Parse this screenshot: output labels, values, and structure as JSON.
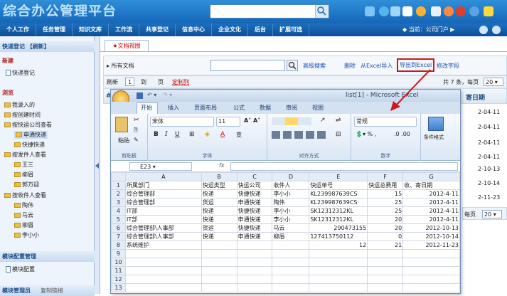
{
  "header": {
    "logo": "综合办公管理平台",
    "top_icons": [
      "home-icon",
      "info-icon",
      "monitor-icon",
      "shirt-icon",
      "sun-icon",
      "mail-icon",
      "flower-icon",
      "power-icon",
      "user-icon",
      "note-icon"
    ]
  },
  "nav": {
    "items": [
      "个人工作",
      "任务管理",
      "知识文库",
      "工作流",
      "共享登记",
      "信息中心",
      "企业文化",
      "后台",
      "扩展可选"
    ],
    "location": "◆ 当前：公司门户 ▶"
  },
  "sidebar": {
    "quick_title": "快递登记 【刷新】",
    "new_label": "新建",
    "new_item": "快递登记",
    "browse_label": "浏览",
    "tree": [
      "我录入的",
      "按创建时间",
      "按快运公司查看",
      "申通快递",
      "快捷快递",
      "按发件人查看",
      "王三",
      "柳眉",
      "郭万迎",
      "按收件人查看",
      "陶伟",
      "马云",
      "柳眉",
      "李小小"
    ],
    "module_title": "模块配置管理",
    "module_item": "模块配置",
    "bottom_label": "模块管理员",
    "bottom_link": "复制链接"
  },
  "tab": {
    "label": "★文档视图"
  },
  "toolbar": {
    "all_docs": "所有文档",
    "advanced_search": "高级搜索",
    "delete": "删除",
    "import_excel": "从Excel导入",
    "export_excel": "导出到Excel",
    "modify_field": "修改字段"
  },
  "pager": {
    "refresh": "刷新",
    "page_num": "1",
    "to": "到",
    "page": "页",
    "custom": "定制列",
    "summary": "共 7 条，每页",
    "page_size": "20"
  },
  "grid": {
    "hash": "#",
    "date_header": "寄日期",
    "dates": [
      "2-04-11",
      "2-04-11",
      "2-04-11",
      "2-04-11",
      "2-10-13",
      "2-10-14",
      "2-11-23"
    ],
    "pager_bottom": "每页",
    "page_size_bottom": "20"
  },
  "excel": {
    "title": "list[1] - Microsoft Excel",
    "tabs": [
      "开始",
      "插入",
      "页面布局",
      "公式",
      "数据",
      "审阅",
      "视图"
    ],
    "groups": [
      "剪贴板",
      "字体",
      "对齐方式",
      "数字"
    ],
    "paste": "粘贴",
    "font_name": "宋体",
    "font_size": "11",
    "number_format": "常规",
    "cond_format": "条件格式",
    "cell_ref": "E23",
    "fx": "fx",
    "columns": [
      "A",
      "B",
      "C",
      "D",
      "E",
      "F",
      "G"
    ],
    "rows": [
      [
        "所属部门",
        "快运类型",
        "快运公司",
        "收件人",
        "快运单号",
        "快运总费用",
        "收、寄日期"
      ],
      [
        "综合管理部",
        "快递",
        "快捷快递",
        "李小小",
        "KL239987639CS",
        "15",
        "2012-4-11"
      ],
      [
        "综合管理部",
        "货运",
        "申通快递",
        "陶伟",
        "KL239987639CS",
        "25",
        "2012-4-11"
      ],
      [
        "IT部",
        "快递",
        "快捷快递",
        "李小小",
        "SK12312312KL",
        "25",
        "2012-4-11"
      ],
      [
        "IT部",
        "快递",
        "申通快递",
        "李小小",
        "SK12312312KL",
        "20",
        "2012-4-11"
      ],
      [
        "综合管理部\\人事部",
        "货运",
        "快捷快递",
        "马云",
        "290473155",
        "20",
        "2012-10-13"
      ],
      [
        "综合管理部\\人事部",
        "快递",
        "申通快递",
        "柳眉",
        "127413750112",
        "0",
        "2012-10-14"
      ],
      [
        "系统维护",
        "",
        "",
        "",
        "12",
        "21",
        "2012-11-23"
      ]
    ],
    "row_numbers": [
      "1",
      "2",
      "3",
      "4",
      "5",
      "6",
      "7",
      "8",
      "9",
      "10",
      "11",
      "12",
      "13"
    ]
  },
  "colors": {
    "accent": "#1566b8",
    "highlight_border": "#cc1a1a"
  }
}
